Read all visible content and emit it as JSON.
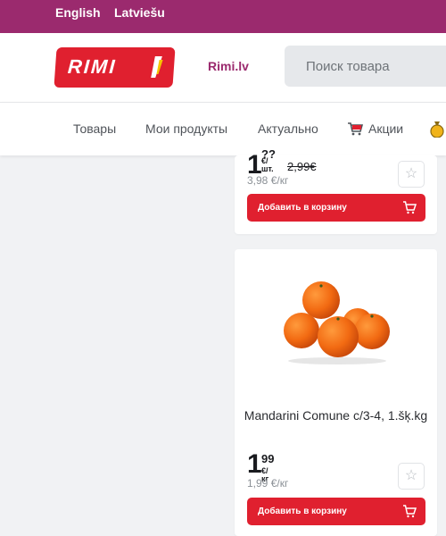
{
  "langbar": {
    "english": "English",
    "latvian": "Latviešu"
  },
  "header": {
    "logo_text": "RIMI",
    "site_link": "Rimi.lv",
    "search_placeholder": "Поиск товара"
  },
  "nav": {
    "items": [
      {
        "label": "Товары",
        "icon": "grid-icon"
      },
      {
        "label": "Мои продукты"
      },
      {
        "label": "Актуально"
      },
      {
        "label": "Акции",
        "icon": "cart-icon"
      },
      {
        "label": "",
        "icon": "coin-bag-icon"
      }
    ]
  },
  "products": [
    {
      "price_int": "1",
      "price_frac": "??",
      "price_unit": "€/шт.",
      "old_price": "2,99€",
      "per_unit": "3,98 €/кг",
      "add_to_cart": "Добавить в корзину"
    },
    {
      "name": "Mandarini Comune c/3-4, 1.šķ.kg",
      "price_int": "1",
      "price_frac": "99",
      "price_unit": "€/кг",
      "per_unit": "1,99 €/кг",
      "add_to_cart": "Добавить в корзину"
    }
  ],
  "colors": {
    "brand_purple": "#9b2a6e",
    "brand_red": "#e0202f",
    "background": "#f1f2f4"
  }
}
